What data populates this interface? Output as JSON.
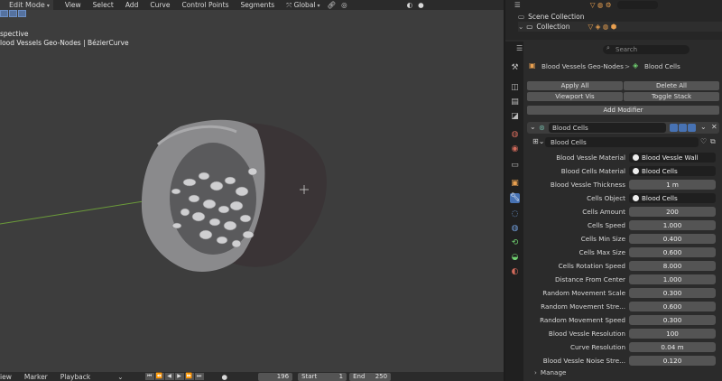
{
  "viewport": {
    "header": {
      "mode": "Edit Mode",
      "menus": [
        "View",
        "Select",
        "Add",
        "Curve",
        "Control Points",
        "Segments"
      ],
      "transform_orientation": "Global"
    },
    "overlay": {
      "line1": "spective",
      "line2": "lood Vessels Geo-Nodes | BézierCurve"
    },
    "timeline": {
      "menus": [
        "iew",
        "Marker",
        "Playback"
      ],
      "frame_current": "196",
      "start_label": "Start",
      "start_value": "1",
      "end_label": "End",
      "end_value": "250"
    }
  },
  "outliner": {
    "scene_collection": "Scene Collection",
    "collection": "Collection"
  },
  "properties": {
    "search_placeholder": "Search",
    "breadcrumb_object": "Blood Vessels Geo-Nodes",
    "breadcrumb_separator": ">",
    "breadcrumb_data": "Blood Cells",
    "apply_all": "Apply All",
    "delete_all": "Delete All",
    "viewport_vis": "Viewport Vis",
    "toggle_stack": "Toggle Stack",
    "add_modifier": "Add Modifier",
    "modifier_name": "Blood Cells",
    "node_group": "Blood Cells",
    "manage": "Manage",
    "fields": [
      {
        "label": "Blood Vessle Material",
        "value": "Blood Vessle Wall",
        "kind": "ref"
      },
      {
        "label": "Blood Cells Material",
        "value": "Blood Cells",
        "kind": "ref"
      },
      {
        "label": "Blood Vessle Thickness",
        "value": "1 m",
        "kind": "num"
      },
      {
        "label": "Cells Object",
        "value": "Blood Cells",
        "kind": "ref"
      },
      {
        "label": "Cells Amount",
        "value": "200",
        "kind": "num"
      },
      {
        "label": "Cells Speed",
        "value": "1.000",
        "kind": "num"
      },
      {
        "label": "Cells Min Size",
        "value": "0.400",
        "kind": "num"
      },
      {
        "label": "Cells Max Size",
        "value": "0.600",
        "kind": "num"
      },
      {
        "label": "Cells Rotation Speed",
        "value": "8.000",
        "kind": "num"
      },
      {
        "label": "Distance From Center",
        "value": "1.000",
        "kind": "num"
      },
      {
        "label": "Random Movement Scale",
        "value": "0.300",
        "kind": "num"
      },
      {
        "label": "Random Movement Stre...",
        "value": "0.600",
        "kind": "num"
      },
      {
        "label": "Random Movement Speed",
        "value": "0.300",
        "kind": "num"
      },
      {
        "label": "Blood Vessle Resolution",
        "value": "100",
        "kind": "num"
      },
      {
        "label": "Curve Resolution",
        "value": "0.04 m",
        "kind": "num"
      },
      {
        "label": "Blood Vessle Noise Stre...",
        "value": "0.120",
        "kind": "num"
      }
    ]
  },
  "colors": {
    "accent": "#4772b3",
    "viewport_bg": "#3d3d3d",
    "panel_bg": "#2b2b2b",
    "field_bg": "#545454"
  }
}
